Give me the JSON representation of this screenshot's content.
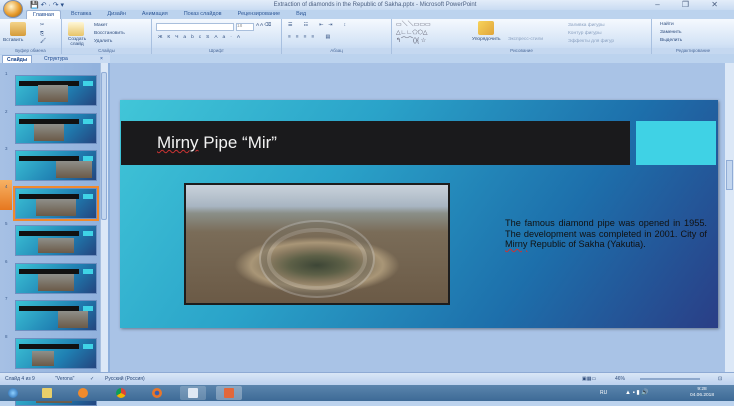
{
  "window": {
    "title": "Extraction of diamonds in the Republic of Sakha.pptx - Microsoft PowerPoint",
    "controls": "– ❐ ✕"
  },
  "qat": "💾 ↶ · ↷ ▾",
  "tabs": [
    "Главная",
    "Вставка",
    "Дизайн",
    "Анимация",
    "Показ слайдов",
    "Рецензирование",
    "Вид"
  ],
  "ribbon": {
    "clipboard": {
      "label": "Буфер обмена",
      "paste": "Вставить"
    },
    "slides": {
      "label": "Слайды",
      "new_slide": "Создать слайд",
      "layout": "Макет",
      "reset": "Восстановить",
      "delete": "Удалить"
    },
    "font": {
      "label": "Шрифт",
      "size": "18"
    },
    "paragraph": {
      "label": "Абзац"
    },
    "drawing": {
      "label": "Рисование",
      "arrange": "Упорядочить",
      "quick_styles": "Экспресс-стили",
      "fill": "Заливка фигуры",
      "outline": "Контур фигуры",
      "effects": "Эффекты для фигур"
    },
    "editing": {
      "label": "Редактирование",
      "find": "Найти",
      "replace": "Заменить",
      "select": "Выделить"
    }
  },
  "pane": {
    "tabs": [
      "Слайды",
      "Структура"
    ],
    "selected": 4,
    "count": 9
  },
  "slide": {
    "title_pre": "Mirny",
    "title_post": " Pipe “Mir”",
    "body_1": "The famous diamond pipe was opened in 1955. The development was completed in 2001. City of ",
    "body_sp": "Mirny",
    "body_2": " Republic of Sakha (Yakutia)."
  },
  "status": {
    "slide": "Слайд 4 из 9",
    "theme": "\"Verona\"",
    "lang": "Русский (Россия)",
    "zoom": "46%"
  },
  "taskbar": {
    "lang": "RU",
    "time": "9:28",
    "date": "04.06.2018"
  }
}
